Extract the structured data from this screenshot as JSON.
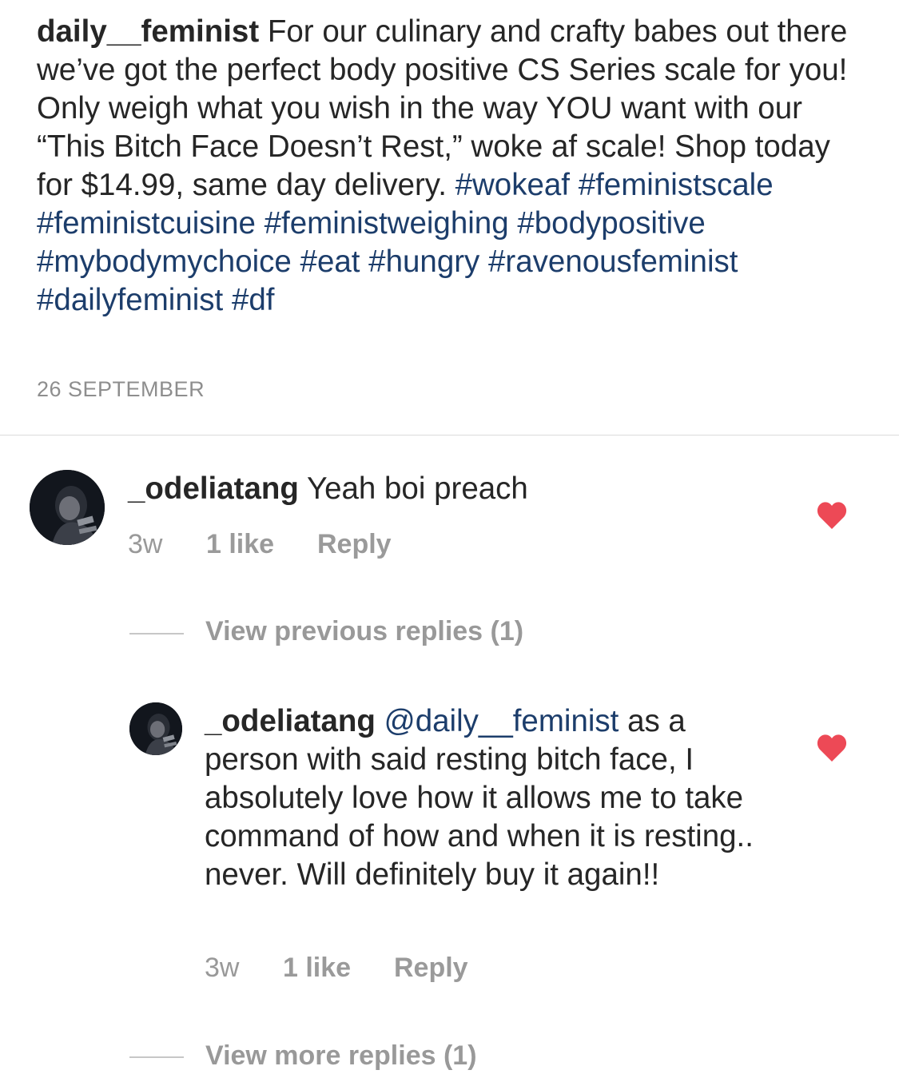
{
  "post": {
    "username": "daily__feminist",
    "caption_text": " For our culinary and crafty babes out there we’ve got the perfect body positive CS Series scale for you! Only weigh what you wish in the way YOU want with our “This Bitch Face Doesn’t Rest,” woke af scale! Shop today for $14.99, same day delivery. ",
    "hashtags": [
      "#wokeaf",
      "#feministscale",
      "#feministcuisine",
      "#feministweighing",
      "#bodypositive",
      "#mybodymychoice",
      "#eat",
      "#hungry",
      "#ravenousfeminist",
      "#dailyfeminist",
      "#df"
    ],
    "timestamp": "26 SEPTEMBER"
  },
  "comments": [
    {
      "username": "_odeliatang",
      "text": " Yeah boi preach",
      "time": "3w",
      "likes": "1 like",
      "reply_label": "Reply",
      "liked": true,
      "view_replies_label": "View previous replies (1)"
    }
  ],
  "replies": [
    {
      "username": "_odeliatang",
      "mention": "@daily__feminist",
      "text": " as a person with said resting bitch face, I absolutely love how it allows me to take command of how and when it is resting.. never. Will definitely buy it again!!",
      "time": "3w",
      "likes": "1 like",
      "reply_label": "Reply",
      "liked": true,
      "view_more_label": "View more replies (1)"
    }
  ],
  "colors": {
    "hashtag": "#1c3d6b",
    "heart": "#ed4956",
    "secondary_text": "#999999"
  },
  "icons": {
    "heart": "heart-icon",
    "avatar": "avatar"
  }
}
